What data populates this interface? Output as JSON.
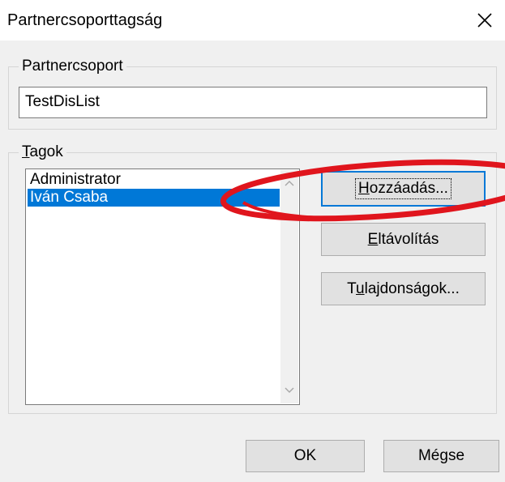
{
  "window": {
    "title": "Partnercsoporttagság",
    "close_icon": "close-icon"
  },
  "group_partner": {
    "legend": "Partnercsoport",
    "value": "TestDisList"
  },
  "group_members": {
    "legend_accel": "T",
    "legend_rest": "agok",
    "items": [
      {
        "label": "Administrator",
        "selected": false
      },
      {
        "label": "Iván Csaba",
        "selected": true
      }
    ],
    "buttons": {
      "add_accel": "H",
      "add_rest": "ozzáadás...",
      "remove_accel": "E",
      "remove_rest": "ltávolítás",
      "props_pre": "T",
      "props_accel": "u",
      "props_rest": "lajdonságok..."
    }
  },
  "footer": {
    "ok_label": "OK",
    "cancel_label": "Mégse"
  },
  "colors": {
    "selection": "#0078d7",
    "annotation": "#e0151d",
    "dialog_bg": "#f0f0f0"
  }
}
